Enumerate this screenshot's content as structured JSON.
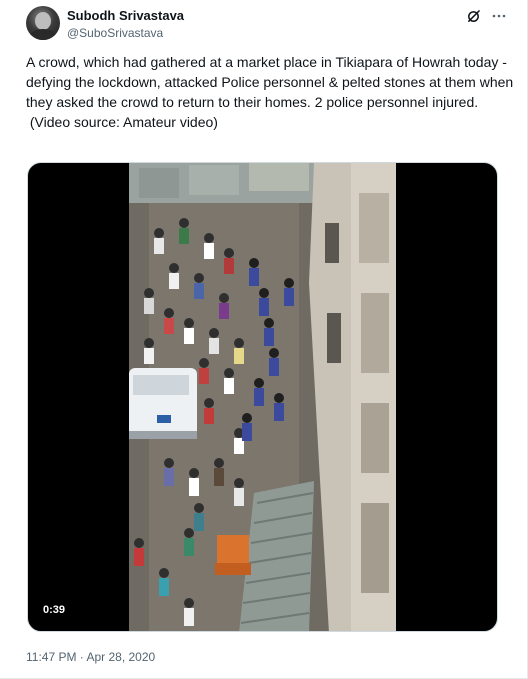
{
  "author": {
    "display_name": "Subodh Srivastava",
    "handle": "@SuboSrivastava",
    "avatar_icon": "profile-photo"
  },
  "actions": {
    "grok_icon": "slash-circle-icon",
    "more_icon": "more-dots-icon"
  },
  "tweet": {
    "text": "A crowd, which had gathered at a market place in Tikiapara of Howrah today - defying the lockdown, attacked Police personnel & pelted stones at them when they asked the crowd to return to their homes. 2 police personnel injured.\n (Video source: Amateur video)"
  },
  "media": {
    "duration": "0:39"
  },
  "meta": {
    "timestamp": "11:47 PM · Apr 28, 2020"
  },
  "colors": {
    "text": "#0f1419",
    "secondary": "#536471",
    "border": "#cfd9de"
  }
}
